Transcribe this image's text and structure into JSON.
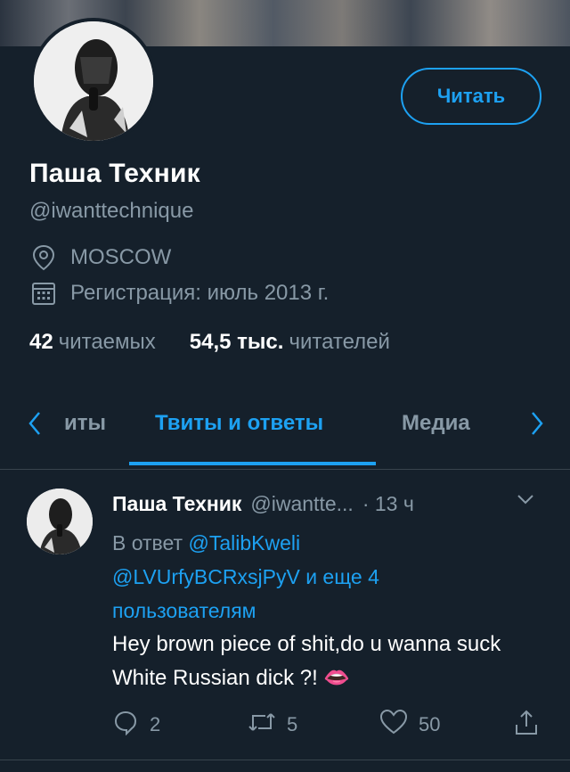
{
  "profile": {
    "follow_label": "Читать",
    "name": "Паша Техник",
    "handle": "@iwanttechnique",
    "location": "MOSCOW",
    "joined": "Регистрация: июль 2013 г.",
    "following_count": "42",
    "following_label": "читаемых",
    "followers_count": "54,5 тыс.",
    "followers_label": "читателей"
  },
  "tabs": {
    "left_partial": "иты",
    "active": "Твиты и ответы",
    "right": "Медиа"
  },
  "tweet": {
    "name": "Паша Техник",
    "handle": "@iwantte...",
    "time": "· 13 ч",
    "reply_prefix": "В ответ",
    "mention1": "@TalibKweli",
    "mention2": "@LVUrfyBCRxsjPyV",
    "reply_suffix1": "и еще 4",
    "reply_suffix2": "пользователям",
    "text": "Hey brown piece of shit,do u wanna suck White Russian dick ?! 👄",
    "replies": "2",
    "retweets": "5",
    "likes": "50"
  },
  "colors": {
    "background": "#15202b",
    "accent": "#1da1f2",
    "muted": "#8899a6",
    "divider": "#38444d"
  },
  "icons": [
    "location-icon",
    "calendar-icon",
    "chevron-left-icon",
    "chevron-right-icon",
    "caret-down-icon",
    "reply-icon",
    "retweet-icon",
    "like-icon",
    "share-icon"
  ]
}
